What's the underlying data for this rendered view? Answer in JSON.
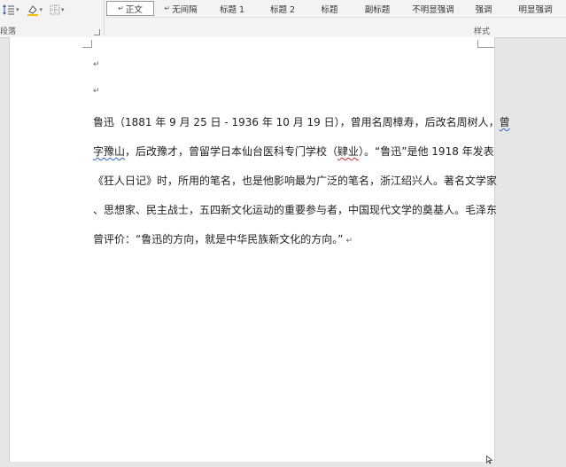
{
  "ribbon": {
    "paragraph_group_label": "段落",
    "styles_group_label": "样式",
    "tools": [
      {
        "icon": "line-spacing-icon"
      },
      {
        "icon": "shading-icon"
      },
      {
        "icon": "borders-icon"
      }
    ],
    "styles": [
      {
        "label": "正文",
        "has_mark": true,
        "active": true
      },
      {
        "label": "无间隔",
        "has_mark": true,
        "active": false
      },
      {
        "label": "标题 1",
        "has_mark": false,
        "active": false
      },
      {
        "label": "标题 2",
        "has_mark": false,
        "active": false
      },
      {
        "label": "标题",
        "has_mark": false,
        "active": false
      },
      {
        "label": "副标题",
        "has_mark": false,
        "active": false
      },
      {
        "label": "不明显强调",
        "has_mark": false,
        "active": false
      },
      {
        "label": "强调",
        "has_mark": false,
        "active": false
      },
      {
        "label": "明显强调",
        "has_mark": false,
        "active": false
      }
    ],
    "paragraph_mark": "↵"
  },
  "document": {
    "empty_paragraph_mark": "↵",
    "lines": [
      {
        "parts": [
          {
            "text": "鲁迅（1881 年 9 月 25 日 - 1936 年 10 月 19 日），曾用名周樟寿，后改名周树人，"
          },
          {
            "text": "曾",
            "squiggle": "blue"
          }
        ]
      },
      {
        "parts": [
          {
            "text": "字豫山",
            "squiggle": "blue"
          },
          {
            "text": "，后改豫才，曾留学日本仙台医科专门学校（"
          },
          {
            "text": "肄业",
            "squiggle": "red"
          },
          {
            "text": "）。“鲁迅”是他 1918 年发表"
          }
        ]
      },
      {
        "parts": [
          {
            "text": "《狂人日记》时，所用的笔名，也是他影响最为广泛的笔名，浙江绍兴人。著名文学家"
          }
        ]
      },
      {
        "parts": [
          {
            "text": "、思想家、民主战士，五四新文化运动的重要参与者，中国现代文学的奠基人。毛泽东"
          }
        ]
      },
      {
        "parts": [
          {
            "text": "曾评价：“鲁迅的方向，就是中华民族新文化的方向。”"
          }
        ],
        "end_mark": "↵"
      }
    ]
  },
  "colors": {
    "ribbon_bg": "#f3f3f3",
    "page_bg": "#ffffff",
    "workspace_bg": "#e6e6e6",
    "spell_error": "#c82a2a",
    "grammar_error": "#2f60c8"
  }
}
